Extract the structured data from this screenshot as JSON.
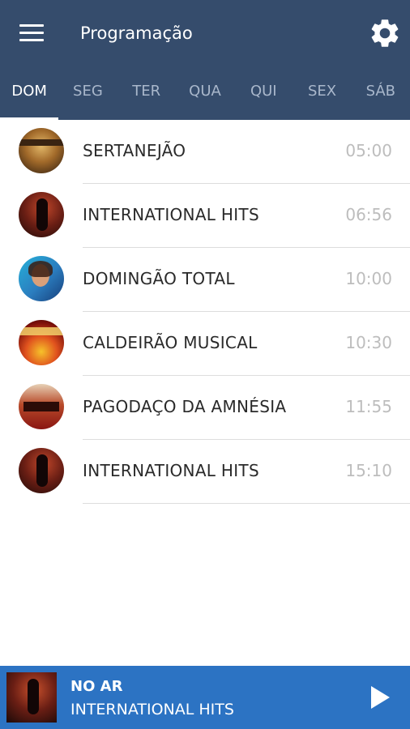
{
  "header": {
    "title": "Programação"
  },
  "tabs": [
    {
      "label": "DOM",
      "active": true
    },
    {
      "label": "SEG",
      "active": false
    },
    {
      "label": "TER",
      "active": false
    },
    {
      "label": "QUA",
      "active": false
    },
    {
      "label": "QUI",
      "active": false
    },
    {
      "label": "SEX",
      "active": false
    },
    {
      "label": "SÁB",
      "active": false
    }
  ],
  "schedule": [
    {
      "name": "SERTANEJÃO",
      "time": "05:00"
    },
    {
      "name": "INTERNATIONAL HITS",
      "time": "06:56"
    },
    {
      "name": "DOMINGÃO TOTAL",
      "time": "10:00"
    },
    {
      "name": "CALDEIRÃO MUSICAL",
      "time": "10:30"
    },
    {
      "name": "PAGODAÇO DA AMNÉSIA",
      "time": "11:55"
    },
    {
      "name": "INTERNATIONAL HITS",
      "time": "15:10"
    }
  ],
  "player": {
    "status": "NO AR",
    "show": "INTERNATIONAL HITS"
  },
  "colors": {
    "header_bg": "#354c6c",
    "player_bg": "#2c73c3",
    "inactive_tab": "#a9b7cb",
    "time_text": "#bdbdbd"
  },
  "icons": {
    "menu": "hamburger-menu-icon",
    "settings": "gear-icon",
    "play": "play-icon"
  }
}
